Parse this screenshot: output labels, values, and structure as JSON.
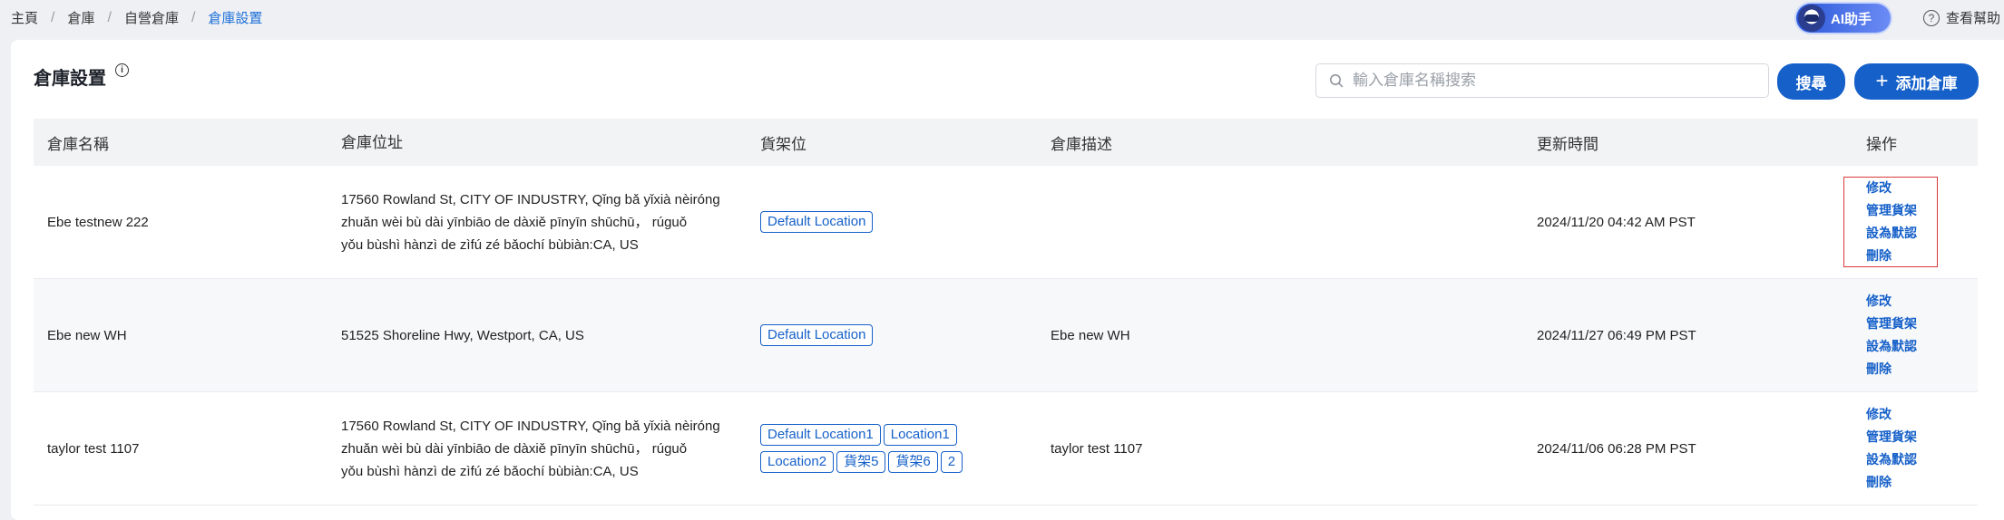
{
  "breadcrumb": {
    "items": [
      "主頁",
      "倉庫",
      "自營倉庫"
    ],
    "current": "倉庫設置",
    "separator": "/"
  },
  "topbar": {
    "ai_label": "AI助手",
    "help_label": "查看幫助"
  },
  "page": {
    "title": "倉庫設置",
    "search_placeholder": "輸入倉庫名稱搜索",
    "search_button": "搜尋",
    "add_button": "添加倉庫"
  },
  "table": {
    "headers": [
      "倉庫名稱",
      "倉庫位址",
      "貨架位",
      "倉庫描述",
      "更新時間",
      "操作"
    ],
    "ops": [
      "修改",
      "管理貨架",
      "設為默認",
      "刪除"
    ],
    "rows": [
      {
        "name": "Ebe testnew 222",
        "address": [
          "17560 Rowland St, CITY OF INDUSTRY, Qǐng bǎ yǐxià nèiróng",
          "zhuǎn wèi bù dài yīnbiāo de dàxiě pīnyīn shūchū， rúguǒ",
          "yǒu bùshì hànzì de zìfú zé bǎochí bùbiàn:CA, US"
        ],
        "shelves": [
          "Default Location"
        ],
        "description": "",
        "updated": "2024/11/20 04:42 AM PST"
      },
      {
        "name": "Ebe new WH",
        "address": [
          "51525 Shoreline Hwy, Westport, CA, US"
        ],
        "shelves": [
          "Default Location"
        ],
        "description": "Ebe new WH",
        "updated": "2024/11/27 06:49 PM PST"
      },
      {
        "name": "taylor test 1107",
        "address": [
          "17560 Rowland St, CITY OF INDUSTRY, Qǐng bǎ yǐxià nèiróng",
          "zhuǎn wèi bù dài yīnbiāo de dàxiě pīnyīn shūchū， rúguǒ",
          "yǒu bùshì hànzì de zìfú zé bǎochí bùbiàn:CA, US"
        ],
        "shelves": [
          "Default Location1",
          "Location1",
          "Location2",
          "貨架5",
          "貨架6",
          "2"
        ],
        "description": "taylor test 1107",
        "updated": "2024/11/06 06:28 PM PST"
      }
    ]
  },
  "colors": {
    "primary": "#1560c9",
    "highlight_box": "#d93a3a"
  }
}
